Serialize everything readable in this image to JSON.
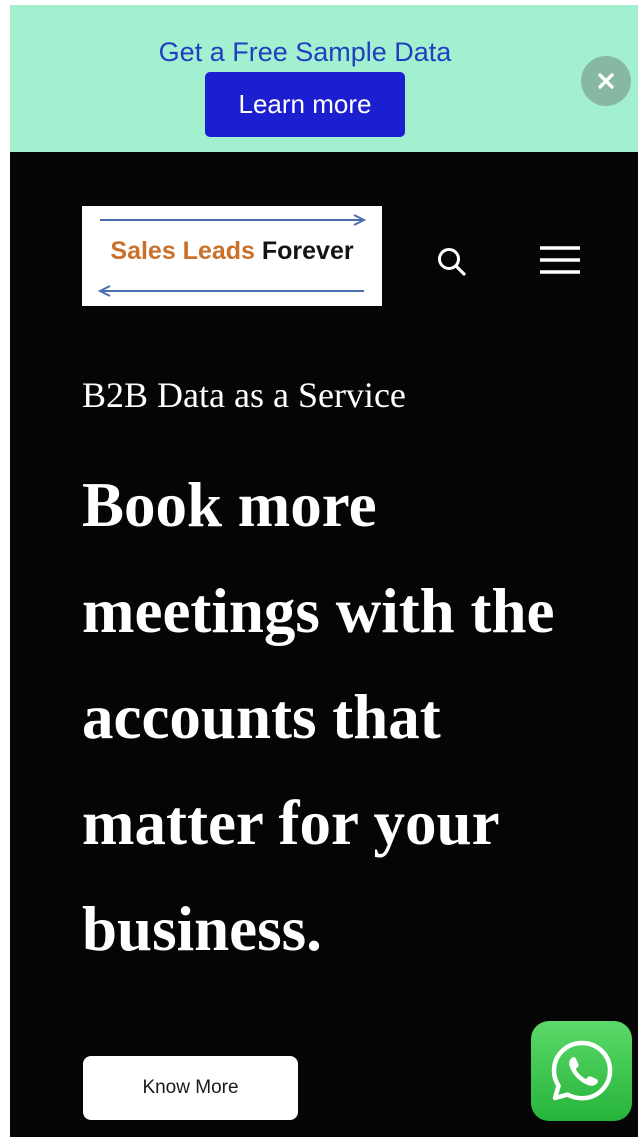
{
  "promo_bar": {
    "text": "Get a Free Sample Data",
    "button_label": "Learn more",
    "close_icon": "close-icon",
    "background_color": "#a3f0d0",
    "button_color": "#1c1fd0"
  },
  "header": {
    "logo": {
      "word_1": "Sales Leads",
      "word_2": "Forever"
    },
    "search_icon": "search-icon",
    "menu_icon": "hamburger-menu-icon"
  },
  "hero": {
    "tagline": "B2B Data as a Service",
    "headline": "Book more meetings with the accounts that matter for your business.",
    "cta_label": "Know More"
  },
  "floating": {
    "whatsapp_icon": "whatsapp-icon",
    "whatsapp_color": "#26b43a"
  }
}
